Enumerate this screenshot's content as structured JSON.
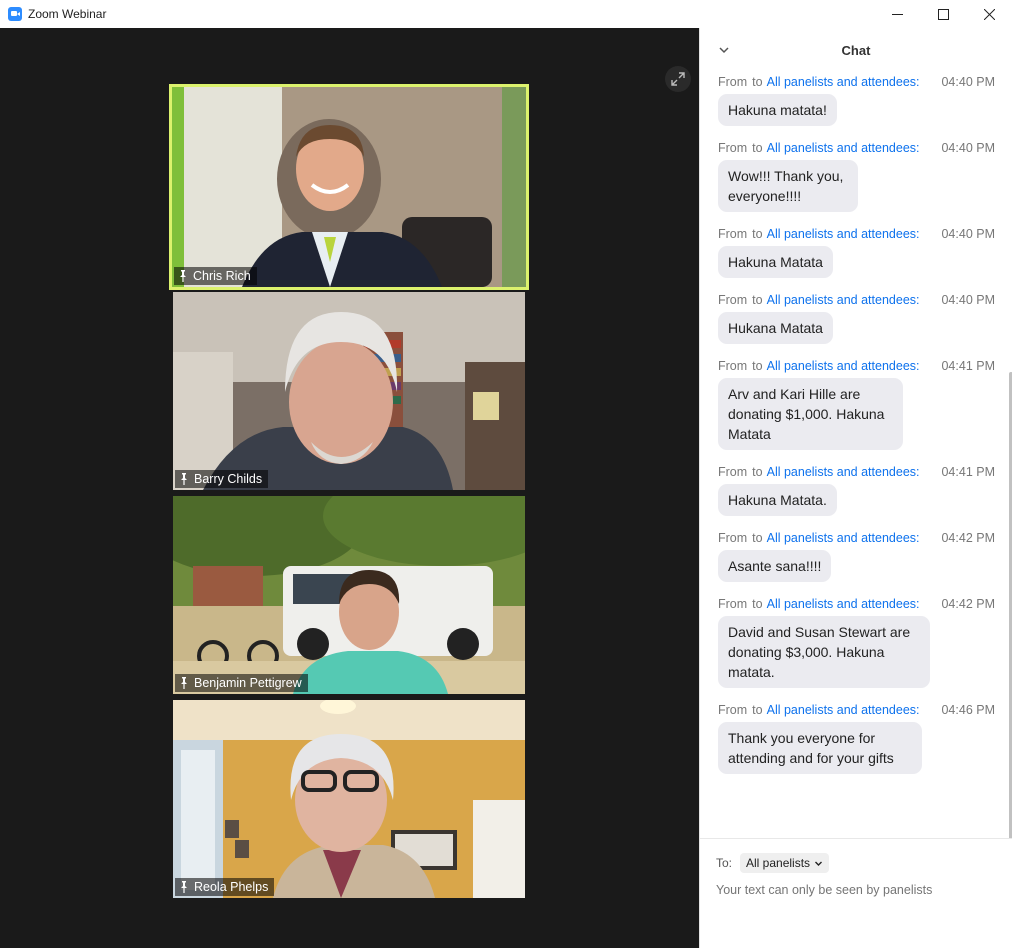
{
  "window": {
    "title": "Zoom Webinar"
  },
  "video": {
    "tiles": [
      {
        "name": "Chris Rich",
        "active": true
      },
      {
        "name": "Barry Childs",
        "active": false
      },
      {
        "name": "Benjamin Pettigrew",
        "active": false
      },
      {
        "name": "Reola Phelps",
        "active": false
      }
    ]
  },
  "chat": {
    "title": "Chat",
    "from_label": "From",
    "to_label": "to",
    "messages": [
      {
        "recipient": "All panelists and attendees:",
        "time": "04:40 PM",
        "text": "Hakuna matata!"
      },
      {
        "recipient": "All panelists and attendees:",
        "time": "04:40 PM",
        "text": "Wow!!! Thank you, everyone!!!!"
      },
      {
        "recipient": "All panelists and attendees:",
        "time": "04:40 PM",
        "text": "Hakuna Matata"
      },
      {
        "recipient": "All panelists and attendees:",
        "time": "04:40 PM",
        "text": "Hukana Matata"
      },
      {
        "recipient": "All panelists and attendees:",
        "time": "04:41 PM",
        "text": "Arv and Kari Hille are donating $1,000. Hakuna Matata"
      },
      {
        "recipient": "All panelists and attendees:",
        "time": "04:41 PM",
        "text": "Hakuna Matata."
      },
      {
        "recipient": "All panelists and attendees:",
        "time": "04:42 PM",
        "text": "Asante sana!!!!"
      },
      {
        "recipient": "All panelists and attendees:",
        "time": "04:42 PM",
        "text": "David and Susan Stewart are donating $3,000. Hakuna matata."
      },
      {
        "recipient": "All panelists and attendees:",
        "time": "04:46 PM",
        "text": "Thank you everyone for attending and for your gifts"
      }
    ],
    "footer": {
      "to_label": "To:",
      "recipient_select": "All panelists",
      "placeholder": "Your text can only be seen by panelists"
    }
  },
  "colors": {
    "active_speaker_border": "#dcf26d",
    "link_blue": "#0e72ed",
    "video_background": "#1a1a1a",
    "bubble": "#ebebf0"
  },
  "icons": [
    "zoom-app-icon",
    "minimize-icon",
    "maximize-icon",
    "close-icon",
    "expand-icon",
    "chevron-down-icon",
    "pin-icon"
  ]
}
